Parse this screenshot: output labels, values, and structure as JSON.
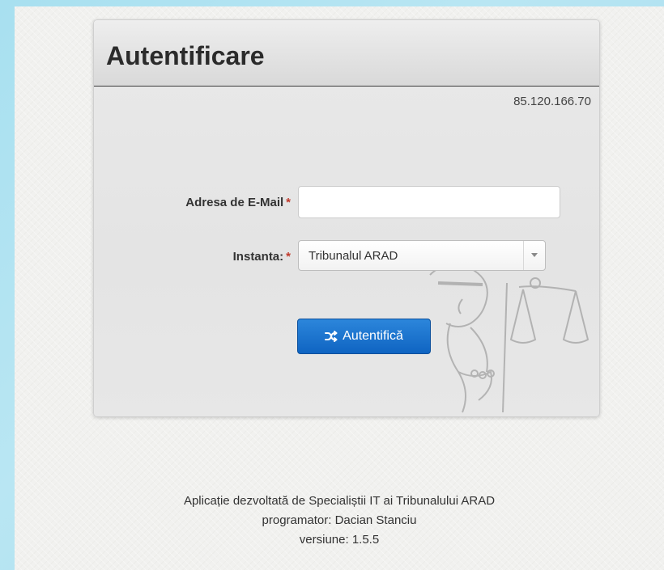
{
  "panel": {
    "title": "Autentificare",
    "ip_address": "85.120.166.70"
  },
  "form": {
    "email": {
      "label": "Adresa de E-Mail",
      "required_mark": "*",
      "value": "",
      "placeholder": ""
    },
    "court": {
      "label": "Instanta:",
      "required_mark": "*",
      "selected": "Tribunalul ARAD"
    },
    "submit": {
      "label": "Autentifică",
      "icon": "shuffle-icon"
    }
  },
  "footer": {
    "line1": "Aplicație dezvoltată de Specialiștii IT ai Tribunalului ARAD",
    "line2": "programator: Dacian Stanciu",
    "line3": "versiune: 1.5.5"
  },
  "colors": {
    "primary_button": "#1270cd",
    "required": "#c0392b",
    "page_background": "#f1f1ef",
    "outer_background": "#a8e0f0"
  }
}
